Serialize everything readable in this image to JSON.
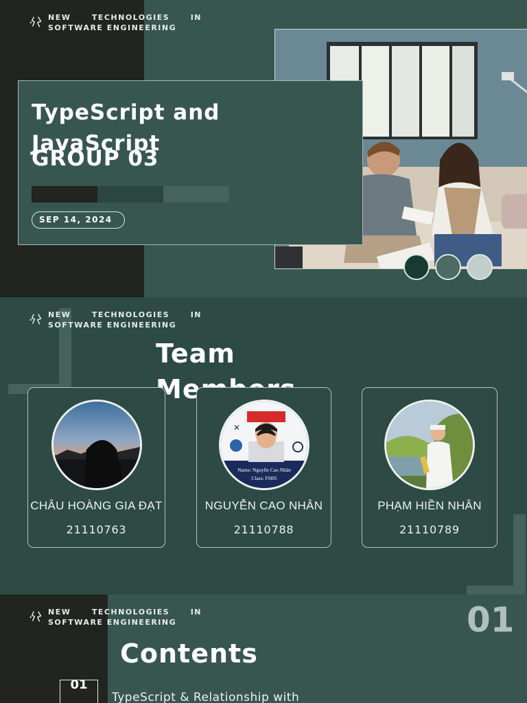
{
  "brand": {
    "words_line1": [
      "NEW",
      "TECHNOLOGIES",
      "IN"
    ],
    "line2": "SOFTWARE ENGINEERING"
  },
  "slide1": {
    "title": "TypeScript and JavaScript",
    "subtitle": "GROUP 03",
    "date": "SEP 14, 2024",
    "colors": {
      "dark": "#22241f",
      "main": "#37564f",
      "bar1": "#22241f",
      "bar2": "#2b4541",
      "bar3": "#45625c"
    },
    "swatches": [
      "#173a33",
      "#4c6b63",
      "#c2ceca"
    ]
  },
  "slide2": {
    "title": "Team Members",
    "members": [
      {
        "name": "CHÂU HOÀNG GIA ĐẠT",
        "id": "21110763"
      },
      {
        "name": "NGUYỄN CAO NHÂN",
        "id": "21110788",
        "photo_caption_name": "Name: Nguyễn Cao Nhân",
        "photo_caption_class": "Class: FH05"
      },
      {
        "name": "PHẠM HIỀN NHÂN",
        "id": "21110789"
      }
    ]
  },
  "slide3": {
    "title": "Contents",
    "page_number": "01",
    "item_number": "01",
    "item_text": "TypeScript & Relationship with"
  }
}
